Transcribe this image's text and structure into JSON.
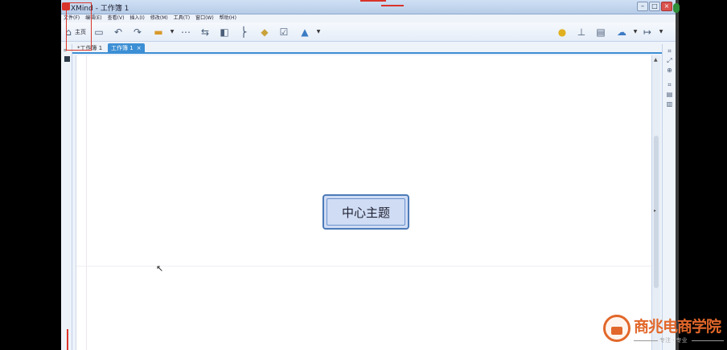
{
  "window": {
    "title": "XMind - 工作簿 1",
    "controls": {
      "minimize": "–",
      "maximize": "□",
      "close": "×"
    }
  },
  "menubar": {
    "items": [
      "文件(F)",
      "编辑(E)",
      "查看(V)",
      "插入(I)",
      "修改(M)",
      "工具(T)",
      "窗口(W)",
      "帮助(H)"
    ]
  },
  "toolbar": {
    "home_label": "主页",
    "icons": [
      "home-icon",
      "save-icon",
      "undo-icon",
      "redo-icon",
      "topic-icon",
      "subtopic-icon",
      "relationship-icon",
      "boundary-icon",
      "summary-icon",
      "marker-icon",
      "note-icon",
      "image-icon",
      "idea-icon",
      "presentation-icon",
      "layout-icon",
      "share-icon",
      "export-icon"
    ]
  },
  "tabs": [
    {
      "label": "*工作簿 1",
      "active": false
    },
    {
      "label": "工作簿 1",
      "active": true,
      "close": "×"
    }
  ],
  "canvas": {
    "central_topic": "中心主题"
  },
  "watermark": {
    "name": "商兆电商学院",
    "tagline": "专注 · 专业"
  },
  "colors": {
    "accent": "#3c8fd4",
    "topic_fill": "#cfdcf4",
    "topic_border": "#4d7bb8",
    "watermark": "#e2672a"
  }
}
